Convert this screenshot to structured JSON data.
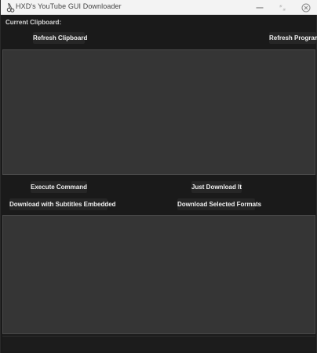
{
  "window": {
    "title": "HXD's YouTube GUI Downloader",
    "icon": "scissors-icon"
  },
  "controls": {
    "minimize_icon": "minimize-icon",
    "maximize_icon": "maximize-icon",
    "close_icon": "close-icon"
  },
  "clipboard": {
    "label": "Current Clipboard:",
    "refresh_clipboard": "Refresh Clipboard",
    "refresh_program": "Refresh Program",
    "content": ""
  },
  "actions": {
    "execute_command": "Execute Command",
    "just_download": "Just Download It",
    "download_subtitles": "Download with Subtitles Embedded",
    "download_selected": "Download Selected Formats"
  },
  "output": {
    "content": ""
  },
  "colors": {
    "background": "#1a1a1a",
    "panel": "#353535",
    "button": "#262626",
    "text": "#f0f0f0"
  }
}
